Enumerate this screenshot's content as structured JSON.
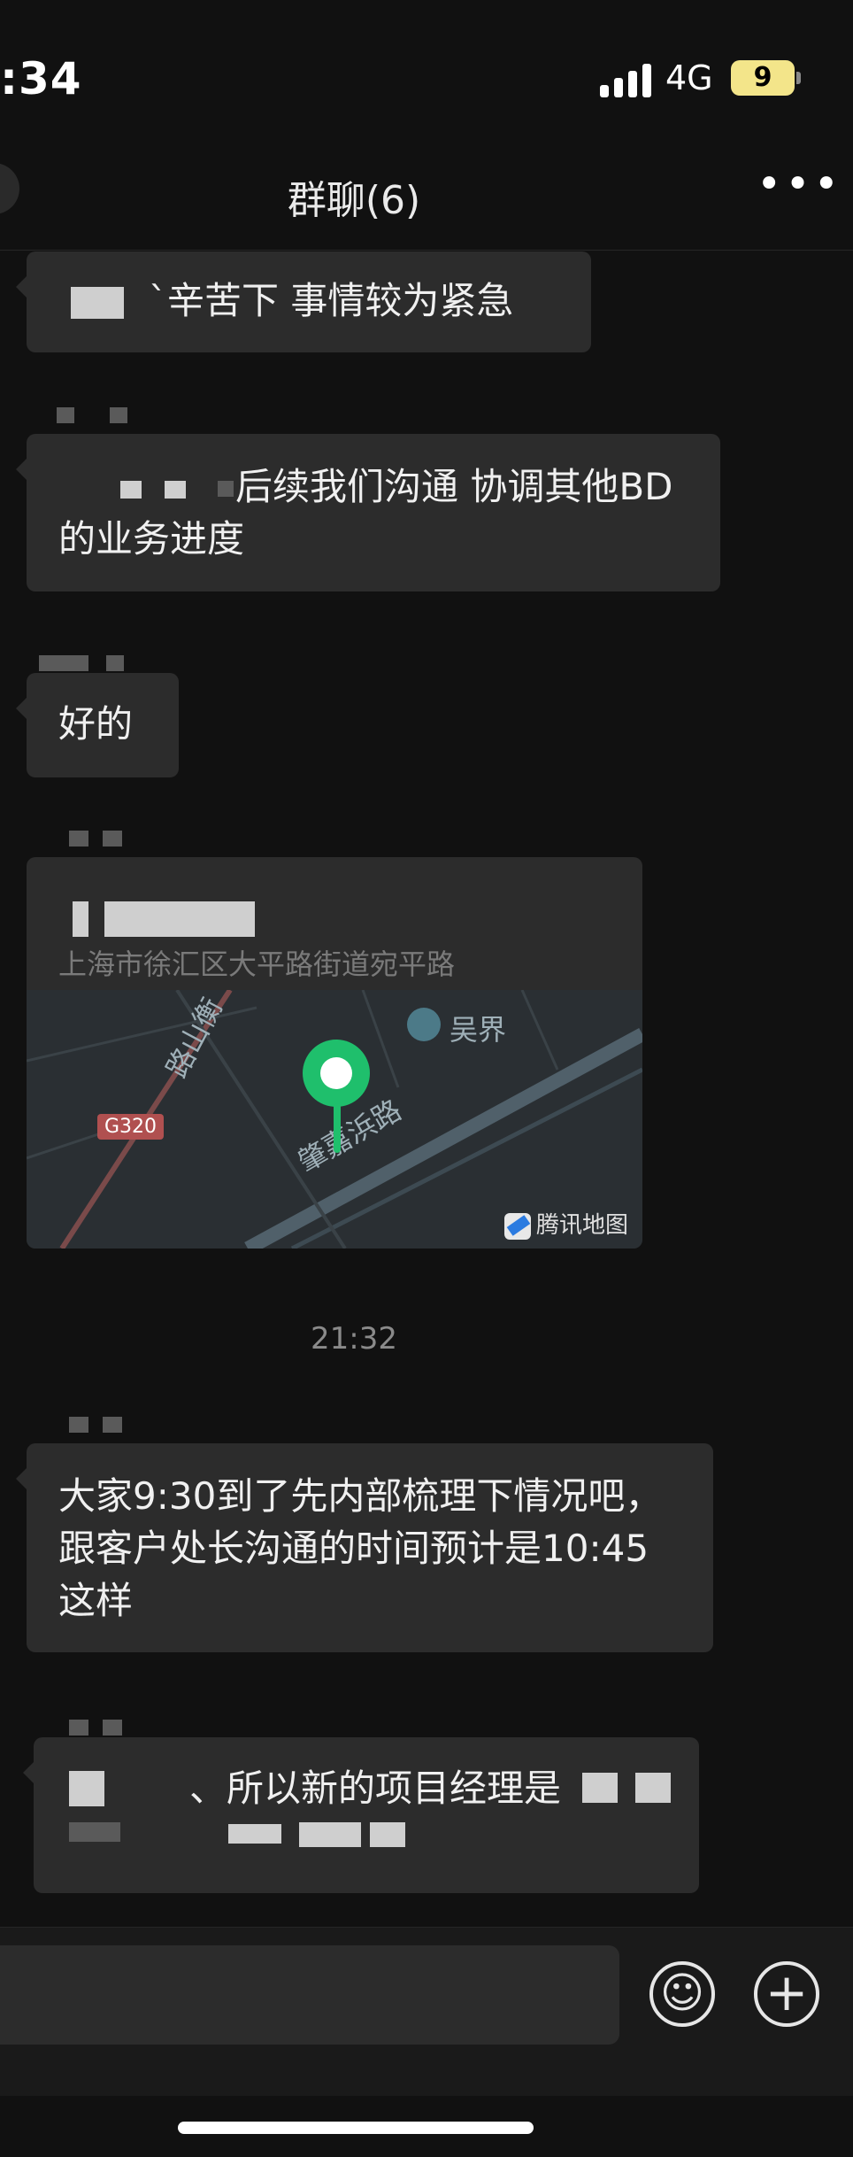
{
  "status": {
    "time": ":34",
    "network": "4G",
    "battery": "9"
  },
  "header": {
    "title": "群聊(6)",
    "more_icon": "more-icon"
  },
  "messages": [
    {
      "text": "`辛苦下 事情较为紧急"
    },
    {
      "text": "后续我们沟通 协调其他BD的业务进度"
    },
    {
      "text": "好的"
    },
    {
      "type": "location",
      "address": "上海市徐汇区大平路街道宛平路",
      "map": {
        "poi": "吴界",
        "road_1": "路山衡",
        "road_2": "肇嘉浜路",
        "highway": "G320",
        "provider": "腾讯地图"
      }
    },
    {
      "text": "大家9:30到了先内部梳理下情况吧，跟客户处长沟通的时间预计是10:45这样"
    },
    {
      "text": "、所以新的项目经理是"
    }
  ],
  "time_separator": "21:32",
  "input": {
    "emoji_icon": "smile-icon",
    "plus_icon": "plus-icon"
  },
  "colors": {
    "background": "#111111",
    "bubble": "#2c2c2c",
    "pin": "#1fbf6c",
    "battery": "#f3e58a"
  }
}
